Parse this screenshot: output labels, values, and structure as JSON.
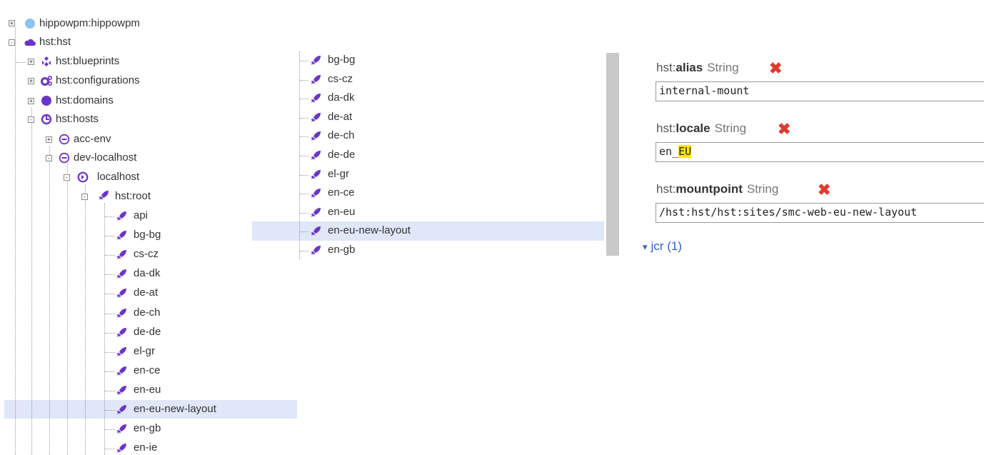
{
  "tree": {
    "top_nodes": [
      {
        "label": "hippowpm:hippowpm",
        "toggle": "+",
        "icon": "circle-icon"
      },
      {
        "label": "hst:hst",
        "toggle": "-",
        "icon": "cloud-icon"
      }
    ],
    "hst_children": [
      {
        "label": "hst:blueprints",
        "toggle": "+",
        "icon": "blueprint-icon"
      },
      {
        "label": "hst:configurations",
        "toggle": "+",
        "icon": "cogs-icon"
      },
      {
        "label": "hst:domains",
        "toggle": "+",
        "icon": "dot-icon"
      },
      {
        "label": "hst:hosts",
        "toggle": "-",
        "icon": "hosts-icon"
      }
    ],
    "hosts_children": [
      {
        "label": "acc-env",
        "toggle": "+",
        "icon": "host-group-icon"
      },
      {
        "label": "dev-localhost",
        "toggle": "-",
        "icon": "host-group-icon"
      }
    ],
    "localhost": {
      "label": "localhost",
      "toggle": "-",
      "icon": "host-icon"
    },
    "root": {
      "label": "hst:root",
      "toggle": "-",
      "icon": "mount-icon"
    },
    "root_children": [
      "api",
      "bg-bg",
      "cs-cz",
      "da-dk",
      "de-at",
      "de-ch",
      "de-de",
      "el-gr",
      "en-ce",
      "en-eu",
      "en-eu-new-layout",
      "en-gb",
      "en-ie"
    ],
    "selected": "en-eu-new-layout"
  },
  "middle_list": {
    "items": [
      "bg-bg",
      "cs-cz",
      "da-dk",
      "de-at",
      "de-ch",
      "de-de",
      "el-gr",
      "en-ce",
      "en-eu",
      "en-eu-new-layout",
      "en-gb"
    ],
    "selected": "en-eu-new-layout"
  },
  "properties": [
    {
      "prefix": "hst:",
      "name": "alias",
      "type": "String",
      "value": "internal-mount"
    },
    {
      "prefix": "hst:",
      "name": "locale",
      "type": "String",
      "value_before": "en_",
      "value_highlight": "EU"
    },
    {
      "prefix": "hst:",
      "name": "mountpoint",
      "type": "String",
      "value": "/hst:hst/hst:sites/smc-web-eu-new-layout"
    }
  ],
  "jcr_section": {
    "arrow": "▾",
    "label": "jcr (1)"
  },
  "colors": {
    "icon": "#6b35c9",
    "selection": "#dfe7f9",
    "delete": "#e23b2e",
    "highlight": "#ffe600"
  }
}
